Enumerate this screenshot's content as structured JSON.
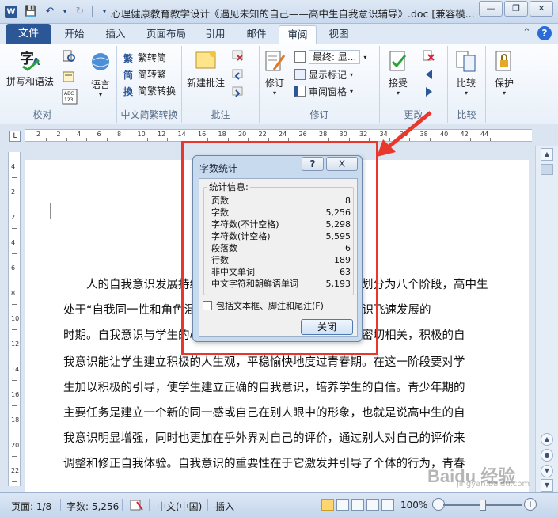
{
  "window": {
    "title": "心理健康教育教学设计《遇见未知的自己——高中生自我意识辅导》.doc [兼容模..."
  },
  "tabs": {
    "file": "文件",
    "items": [
      "开始",
      "插入",
      "页面布局",
      "引用",
      "邮件",
      "审阅",
      "视图"
    ],
    "active": "审阅"
  },
  "ribbon": {
    "proofing": {
      "label": "校对",
      "spelling": "拼写和语法",
      "language": "语言"
    },
    "chinese": {
      "label": "中文简繁转换",
      "t2s": "繁转简",
      "s2t": "简转繁",
      "convert": "简繁转换"
    },
    "comments": {
      "label": "批注",
      "new": "新建批注"
    },
    "tracking": {
      "label": "修订",
      "track": "修订",
      "final_view": "最终: 显...",
      "show_markup": "显示标记",
      "review_pane": "审阅窗格"
    },
    "changes": {
      "label": "更改",
      "accept": "接受"
    },
    "compare": {
      "label": "比较",
      "compare": "比较"
    },
    "protect": {
      "label": "",
      "protect": "保护"
    }
  },
  "ruler": {
    "numbers": [
      "2",
      "2",
      "4",
      "6",
      "8",
      "10",
      "12",
      "14",
      "16",
      "18",
      "20",
      "22",
      "24",
      "26",
      "28",
      "30",
      "32",
      "34",
      "36",
      "38",
      "40",
      "42",
      "44"
    ],
    "vnumbers": [
      "4",
      "2",
      "2",
      "4",
      "6",
      "8",
      "10",
      "12",
      "14",
      "16",
      "18",
      "20",
      "22"
    ],
    "corner": "L"
  },
  "document": {
    "lines": [
      "　　人的自我意识发展持续一生，一般可以将自我意识发展划分为八个阶段，高中生",
      "处于“自我同一性和角色混乱”阶段，这一时期的学生自我意识飞速发展的",
      "时期。自我意识与学生的心理健康、学业成就和人际关系等密切相关，积极的自",
      "我意识能让学生建立积极的人生观，平稳愉快地度过青春期。在这一阶段要对学",
      "生加以积极的引导，使学生建立正确的自我意识，培养学生的自信。青少年期的",
      "主要任务是建立一个新的同一感或自己在别人眼中的形象，也就是说高中生的自",
      "我意识明显增强，同时也更加在乎外界对自己的评价，通过别人对自己的评价来",
      "调整和修正自我体验。自我意识的重要性在于它激发并引导了个体的行为，青春"
    ]
  },
  "dialog": {
    "title": "字数统计",
    "help_label": "?",
    "close_icon": "X",
    "stats_legend": "统计信息:",
    "stats": [
      {
        "label": "页数",
        "value": "8"
      },
      {
        "label": "字数",
        "value": "5,256"
      },
      {
        "label": "字符数(不计空格)",
        "value": "5,298"
      },
      {
        "label": "字符数(计空格)",
        "value": "5,595"
      },
      {
        "label": "段落数",
        "value": "6"
      },
      {
        "label": "行数",
        "value": "189"
      },
      {
        "label": "非中文单词",
        "value": "63"
      },
      {
        "label": "中文字符和朝鲜语单词",
        "value": "5,193"
      }
    ],
    "checkbox_label": "包括文本框、脚注和尾注(F)",
    "close_button": "关闭"
  },
  "statusbar": {
    "page": "页面: 1/8",
    "words": "字数: 5,256",
    "language": "中文(中国)",
    "mode": "插入",
    "zoom": "100%",
    "zoom_percent": 100
  },
  "watermark": {
    "text": "Baidu 经验",
    "sub": "jingyan.baidu.com"
  },
  "colors": {
    "accent": "#2b5797",
    "highlight": "#e8382c"
  }
}
